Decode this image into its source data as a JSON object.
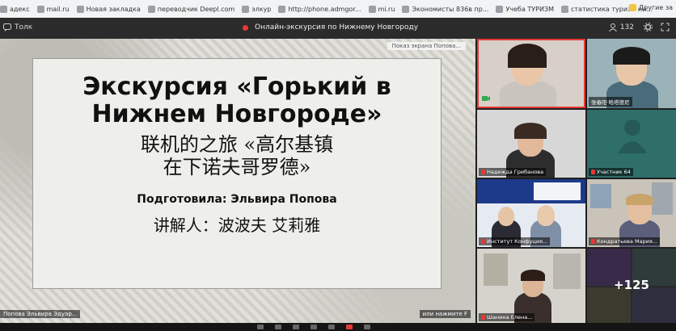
{
  "bookmarks": {
    "items": [
      "адекс",
      "mail.ru",
      "Новая закладка",
      "переводчик Deepl.com",
      "элкур",
      "http://phone.admgor...",
      "mi.ru",
      "Экономисты 836в пр...",
      "Учеба ТУРИЗМ",
      "статистика туризм ни..."
    ],
    "other_label": "Другие за"
  },
  "titlebar": {
    "app_name": "Толк",
    "meeting_title": "Онлайн-экскурсия по Нижнему Новгороду",
    "participant_count": "132"
  },
  "slide": {
    "title_line1": "Экскурсия «Горький в",
    "title_line2": "Нижнем Новгороде»",
    "chinese_line1": "联机的之旅 «高尔基镇",
    "chinese_line2": "在下诺夫哥罗德»",
    "prepared_by": "Подготовила: Эльвира Попова",
    "narrator": "讲解人：波波夫 艾莉雅"
  },
  "main_video": {
    "screen_share_tag": "Показ экрана Попова...",
    "presenter_name": "Попова Эльвира Эдуар...",
    "right_name": "или нажмите F"
  },
  "participants": [
    {
      "name": "",
      "muted": false
    },
    {
      "name": "张春阳·哈塔德尼",
      "muted": false
    },
    {
      "name": "Надежда Грибанова",
      "muted": true
    },
    {
      "name": "Участник 64",
      "muted": true
    },
    {
      "name": "Институт Конфуция...",
      "muted": true
    },
    {
      "name": "Кондратьева Мария...",
      "muted": true
    },
    {
      "name": "Шанина Елена...",
      "muted": true
    },
    {
      "name": "",
      "muted": false
    }
  ],
  "more_count": "+125",
  "colors": {
    "accent_red": "#e53935",
    "teal_tile": "#2e6f6a"
  }
}
